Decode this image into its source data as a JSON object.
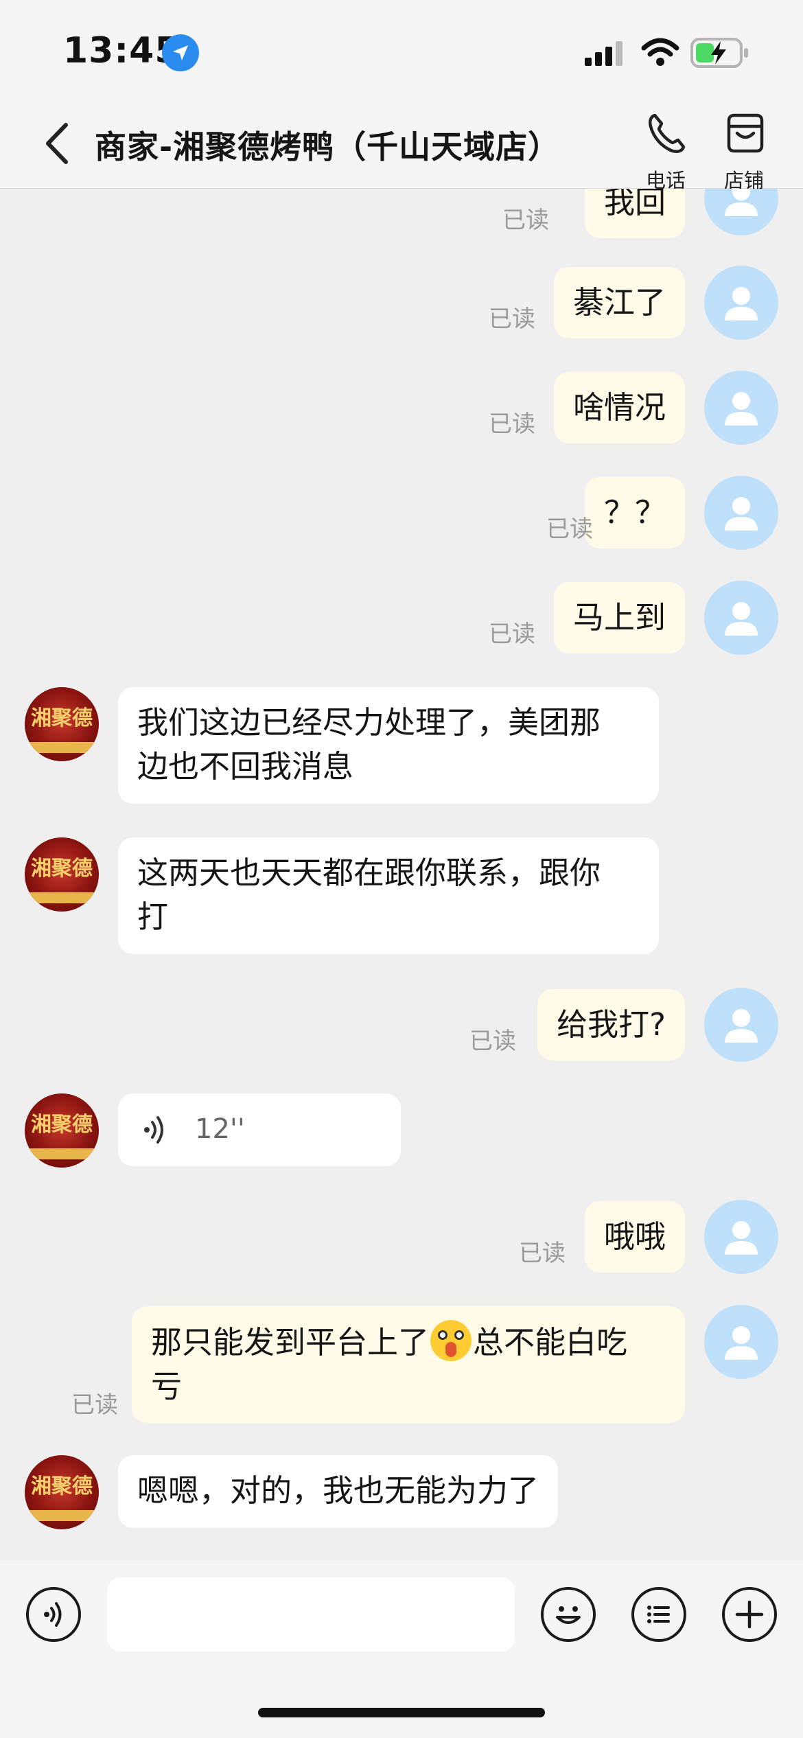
{
  "status_bar": {
    "time": "13:45"
  },
  "header": {
    "title": "商家-湘聚德烤鸭（千山天域店）",
    "actions": [
      {
        "label": "电话",
        "icon": "phone-icon"
      },
      {
        "label": "店铺",
        "icon": "store-icon"
      }
    ]
  },
  "shop_avatar_text": "湘聚德",
  "read_label": "已读",
  "messages": [
    {
      "side": "out",
      "text": "我回",
      "read": "已读"
    },
    {
      "side": "out",
      "text": "綦江了",
      "read": "已读"
    },
    {
      "side": "out",
      "text": "啥情况",
      "read": "已读"
    },
    {
      "side": "out",
      "text": "？？",
      "read": "已读"
    },
    {
      "side": "out",
      "text": "马上到",
      "read": "已读"
    },
    {
      "side": "in",
      "text_line1": "我们这边已经尽力处理了，美团那",
      "text_line2": "边也不回我消息"
    },
    {
      "side": "in",
      "text_line1": "这两天也天天都在跟你联系，跟你",
      "text_line2": "打"
    },
    {
      "side": "out",
      "text": "给我打?",
      "read": "已读"
    },
    {
      "side": "in",
      "type": "voice",
      "duration": "12''"
    },
    {
      "side": "out",
      "text": "哦哦",
      "read": "已读"
    },
    {
      "side": "out",
      "text_before_emoji": "那只能发到平台上了",
      "emoji": "screaming-face-emoji",
      "text_after_emoji": "总不能白吃",
      "text_line2": "亏",
      "read": "已读"
    },
    {
      "side": "in",
      "text": "嗯嗯，对的，我也无能为力了"
    }
  ],
  "input_bar": {
    "placeholder": "",
    "icons": [
      "voice-toggle-icon",
      "emoji-icon",
      "quick-reply-icon",
      "plus-icon"
    ]
  },
  "colors": {
    "background": "#efefef",
    "outgoing_bubble": "#fffbe8",
    "incoming_bubble": "#ffffff",
    "user_avatar": "#bfe0fb",
    "location_badge": "#2b8cf0",
    "battery_fill": "#4cd964"
  }
}
